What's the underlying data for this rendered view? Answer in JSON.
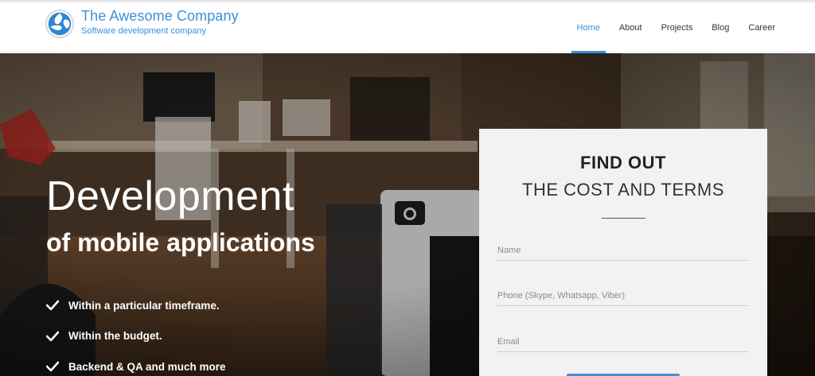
{
  "header": {
    "brand_title": "The Awesome Company",
    "brand_subtitle": "Software development company",
    "logo_icon": "globe-logo-icon",
    "accent_color": "#3d8fd6"
  },
  "nav": {
    "items": [
      {
        "label": "Home",
        "active": true
      },
      {
        "label": "About",
        "active": false
      },
      {
        "label": "Projects",
        "active": false
      },
      {
        "label": "Blog",
        "active": false
      },
      {
        "label": "Career",
        "active": false
      }
    ]
  },
  "hero": {
    "title": "Development",
    "subtitle": "of mobile applications",
    "bullets": [
      "Within a particular timeframe.",
      "Within the budget.",
      "Backend & QA and much more"
    ],
    "bullet_icon": "checkmark-icon"
  },
  "form": {
    "title_line1": "FIND OUT",
    "title_line2": "THE COST AND TERMS",
    "name_placeholder": "Name",
    "phone_placeholder": "Phone (Skype, Whatsapp, Viber)",
    "email_placeholder": "Email",
    "button_color": "#4a90d6"
  }
}
